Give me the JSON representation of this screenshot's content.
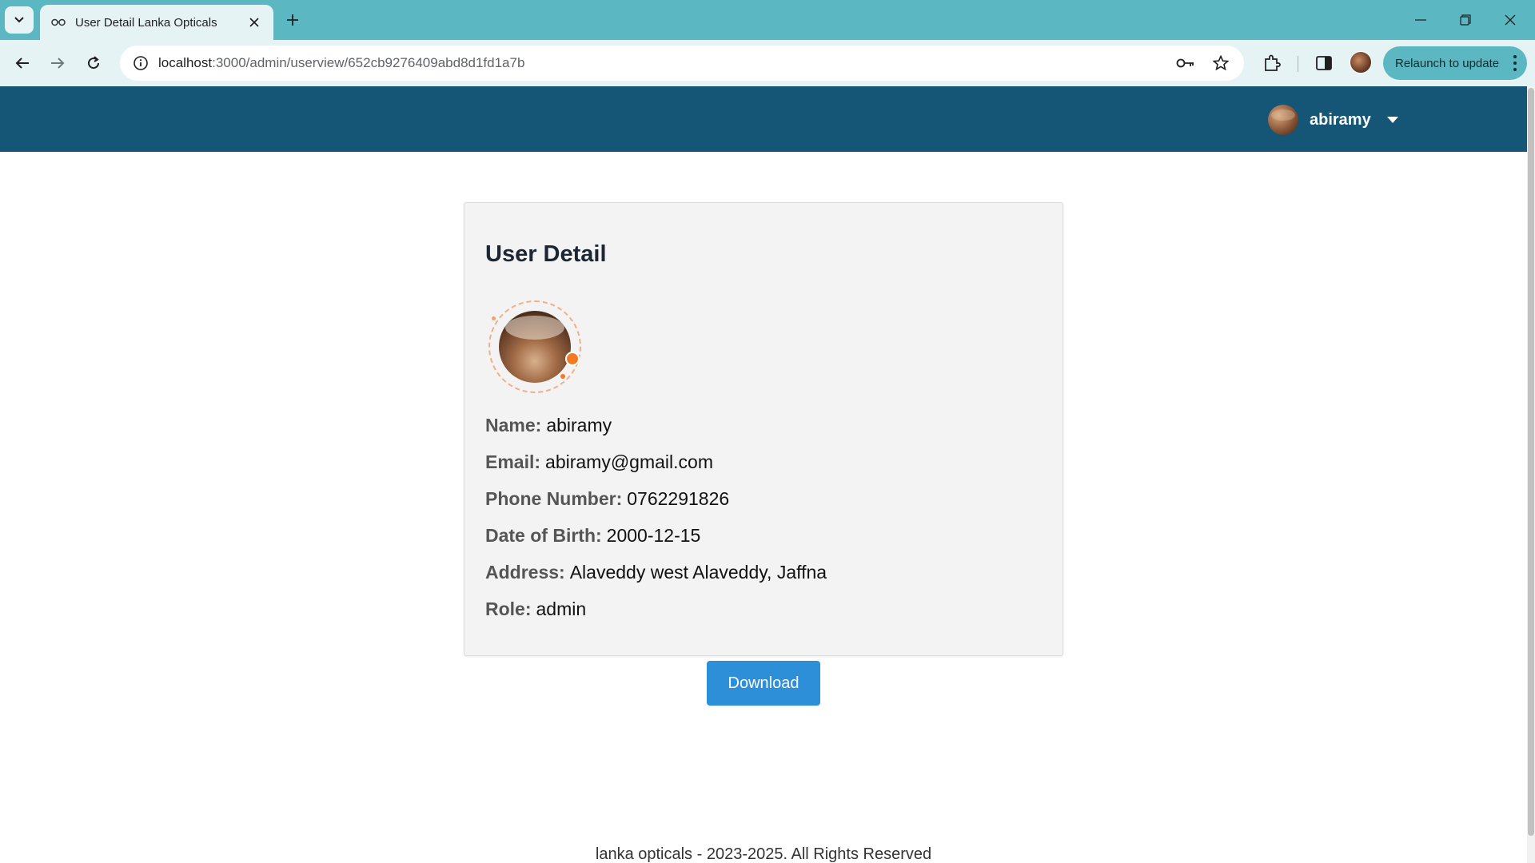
{
  "browser": {
    "tab_title": "User Detail Lanka Opticals",
    "url_host": "localhost",
    "url_path": ":3000/admin/userview/652cb9276409abd8d1fd1a7b",
    "relaunch_label": "Relaunch to update"
  },
  "header": {
    "user_name": "abiramy"
  },
  "card": {
    "title": "User Detail",
    "fields": [
      {
        "label": "Name:",
        "value": "abiramy"
      },
      {
        "label": "Email:",
        "value": "abiramy@gmail.com"
      },
      {
        "label": "Phone Number:",
        "value": "0762291826"
      },
      {
        "label": "Date of Birth:",
        "value": "2000-12-15"
      },
      {
        "label": "Address:",
        "value": "Alaveddy west Alaveddy, Jaffna"
      },
      {
        "label": "Role:",
        "value": "admin"
      }
    ]
  },
  "download_label": "Download",
  "footer_text": "lanka opticals - 2023-2025. All Rights Reserved",
  "colors": {
    "tabstrip": "#5bb8c2",
    "header": "#155575",
    "button": "#2d8fd8",
    "card": "#f3f3f3"
  },
  "icons": [
    "tab-search-icon",
    "glasses-icon",
    "close-icon",
    "plus-icon",
    "minimize-icon",
    "restore-icon",
    "back-icon",
    "forward-icon",
    "reload-icon",
    "site-info-icon",
    "key-icon",
    "star-icon",
    "extensions-icon",
    "side-panel-icon",
    "more-icon",
    "caret-down-icon"
  ]
}
